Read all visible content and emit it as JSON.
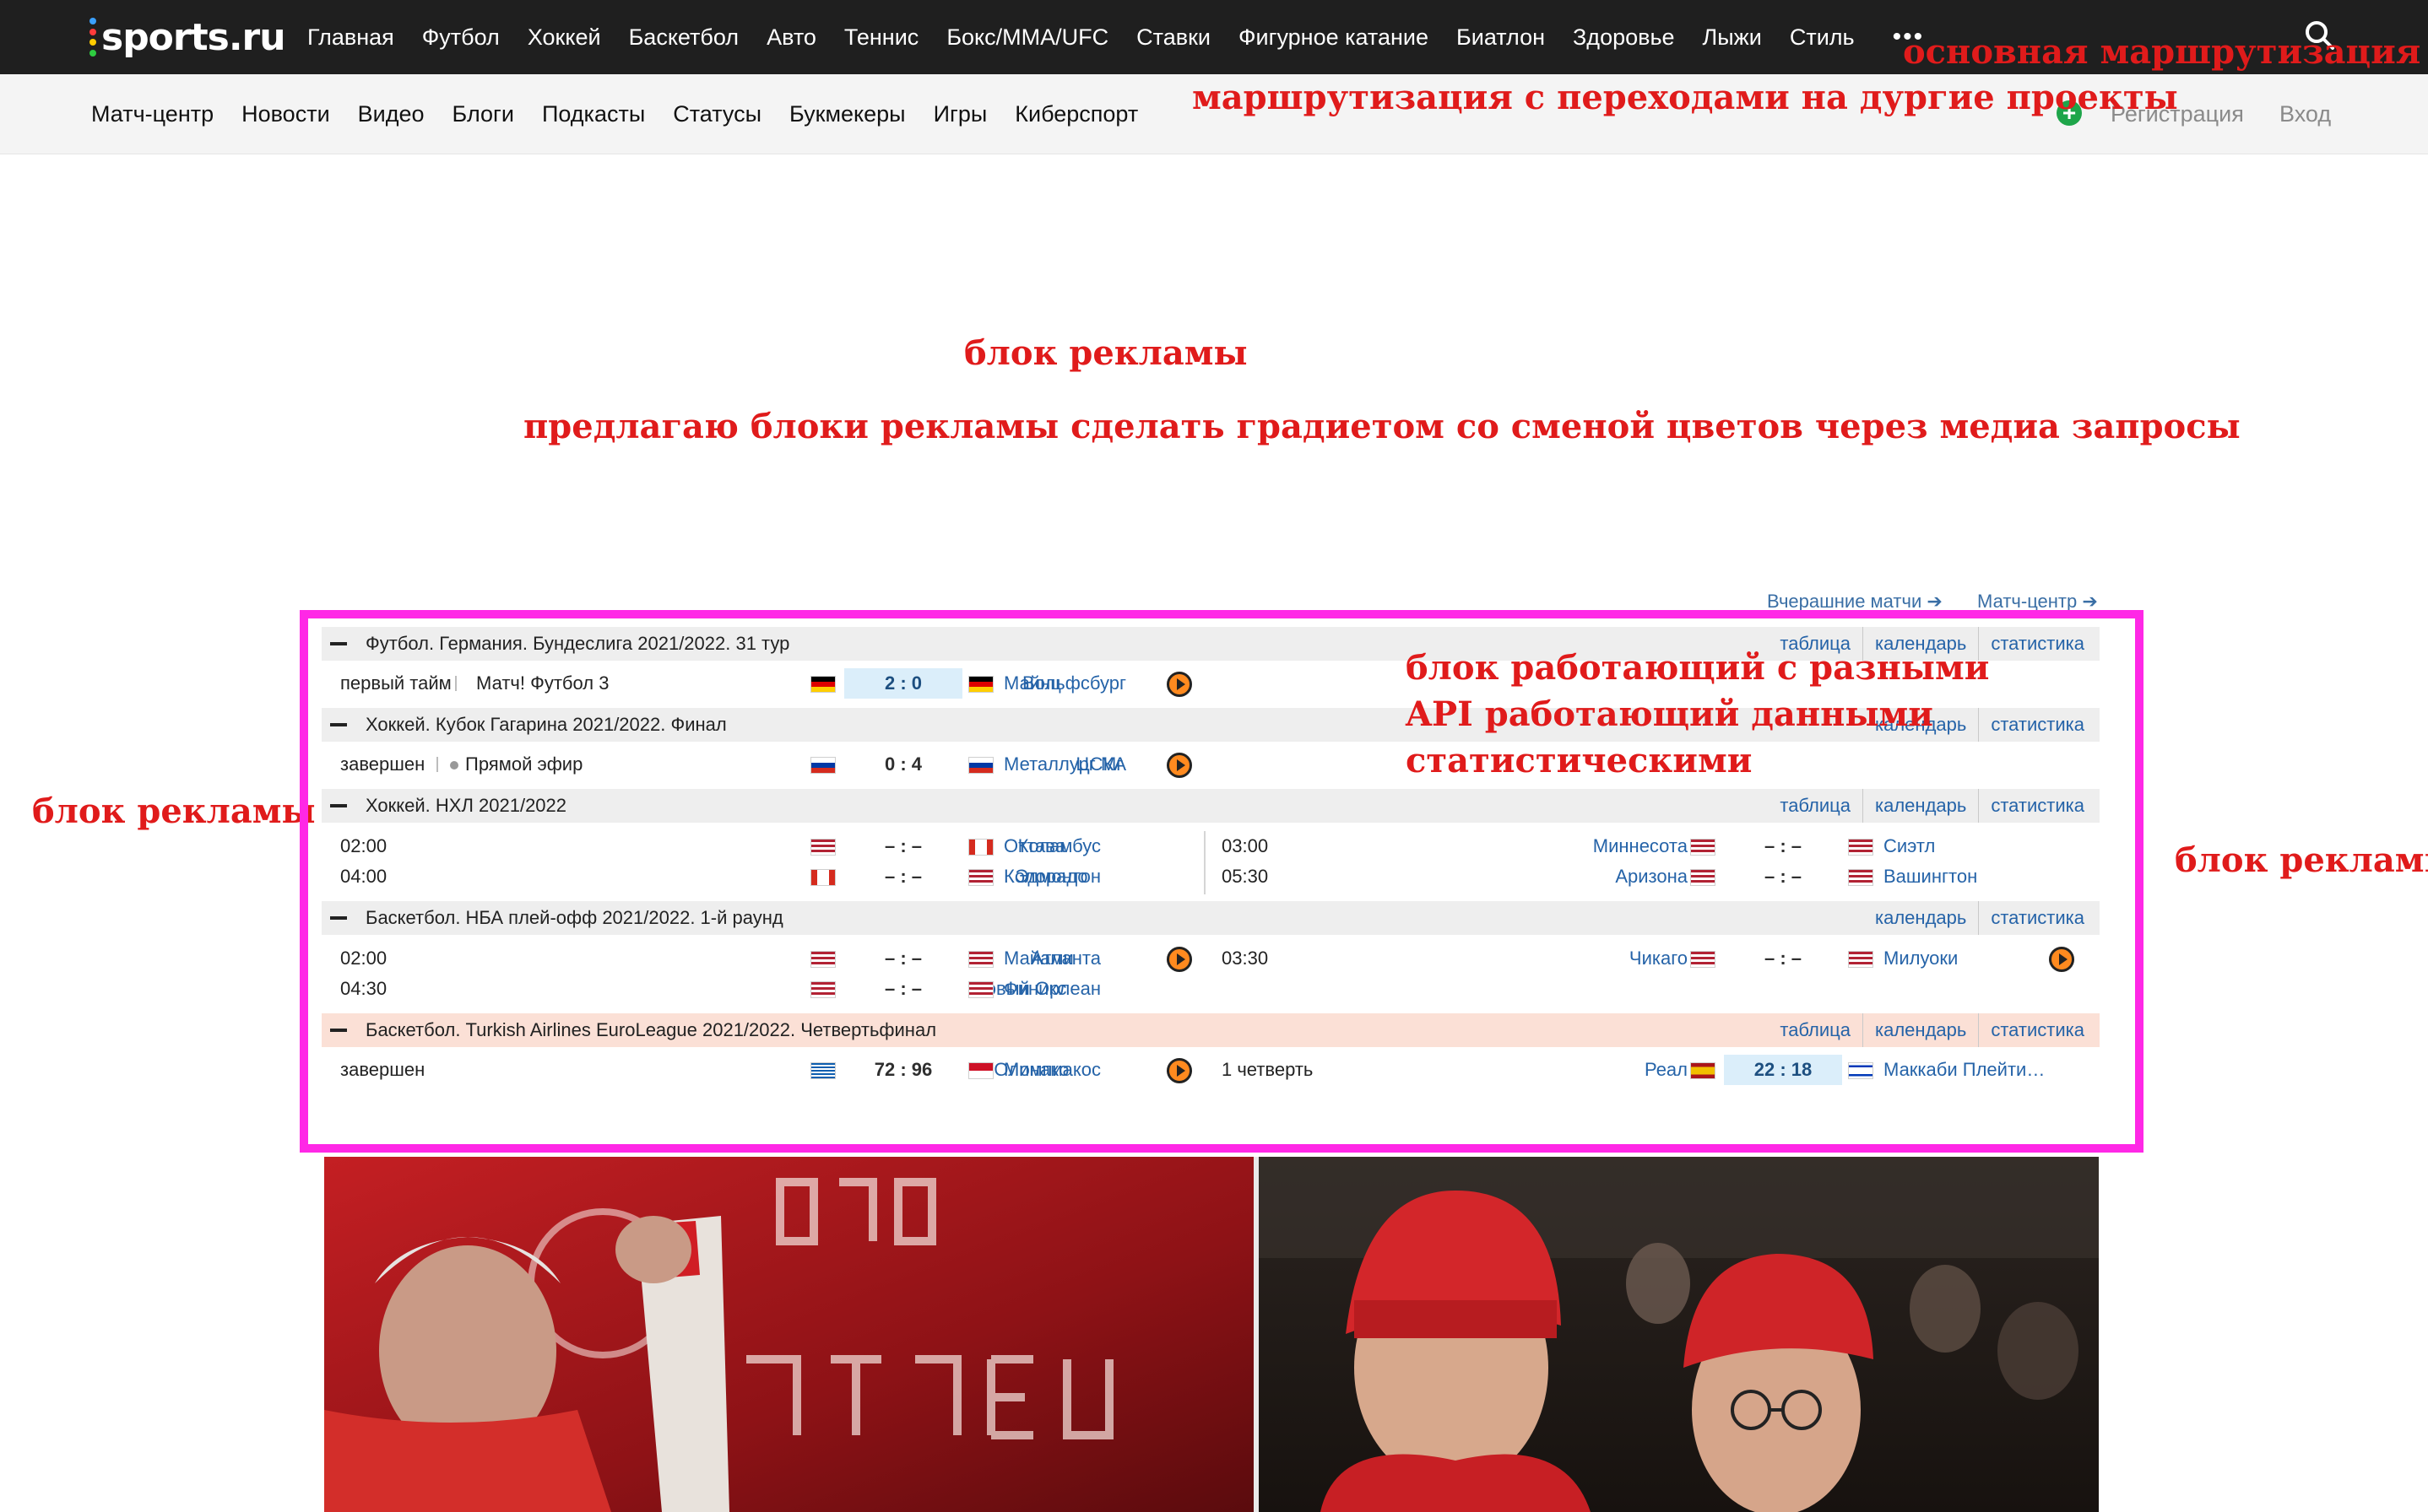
{
  "logo": {
    "text": "sports.ru"
  },
  "main_nav": [
    "Главная",
    "Футбол",
    "Хоккей",
    "Баскетбол",
    "Авто",
    "Теннис",
    "Бокс/MMA/UFC",
    "Ставки",
    "Фигурное катание",
    "Биатлон",
    "Здоровье",
    "Лыжи",
    "Стиль"
  ],
  "more_label": "•••",
  "sub_nav": [
    "Матч-центр",
    "Новости",
    "Видео",
    "Блоги",
    "Подкасты",
    "Статусы",
    "Букмекеры",
    "Игры",
    "Киберспорт"
  ],
  "auth": {
    "register": "Регистрация",
    "login": "Вход"
  },
  "plus_label": "+",
  "annotations": {
    "main_routing": "основная маршрутизация",
    "projects_routing": "маршрутизация с переходами на дургие проекты",
    "ad_top": "блок рекламы",
    "ad_gradient": "предлагаю блоки рекламы сделать градиетом со сменой цветов через медиа запросы",
    "ad_left": "блок рекламы",
    "ad_right": "блок рекламы",
    "api_block_1": "блок работающий с разными",
    "api_block_2": "API работающий данными",
    "api_block_3": "статистическими"
  },
  "match_center": {
    "yesterday_link": "Вчерашние матчи ➔",
    "center_link": "Матч-центр ➔",
    "links": {
      "table": "таблица",
      "calendar": "календарь",
      "stats": "статистика"
    },
    "sections": [
      {
        "title": "Футбол. Германия. Бундеслига 2021/2022. 31 тур"
      },
      {
        "title": "Хоккей. Кубок Гагарина 2021/2022. Финал"
      },
      {
        "title": "Хоккей. НХЛ 2021/2022"
      },
      {
        "title": "Баскетбол. НБА плей-офф 2021/2022. 1-й раунд"
      },
      {
        "title": "Баскетбол. Turkish Airlines EuroLeague 2021/2022. Четвертьфинал"
      }
    ],
    "football": {
      "status": "первый тайм",
      "broadcast": "Матч! Футбол 3",
      "home": "Вольфсбург",
      "score": "2 : 0",
      "away": "Майнц"
    },
    "khl": {
      "status": "завершен",
      "broadcast": "Прямой эфир",
      "home": "ЦСКА",
      "score": "0 : 4",
      "away": "Металлург Мг"
    },
    "nhl": [
      {
        "time": "02:00",
        "home": "Коламбус",
        "score": "– : –",
        "away": "Оттава"
      },
      {
        "time": "04:00",
        "home": "Эдмонтон",
        "score": "– : –",
        "away": "Колорадо"
      },
      {
        "time": "03:00",
        "home": "Миннесота",
        "score": "– : –",
        "away": "Сиэтл"
      },
      {
        "time": "05:30",
        "home": "Аризона",
        "score": "– : –",
        "away": "Вашингтон"
      }
    ],
    "nba": [
      {
        "time": "02:00",
        "home": "Атланта",
        "score": "– : –",
        "away": "Майами"
      },
      {
        "time": "04:30",
        "home": "Новый Орлеан",
        "score": "– : –",
        "away": "Финикс"
      },
      {
        "time": "03:30",
        "home": "Чикаго",
        "score": "– : –",
        "away": "Милуоки"
      }
    ],
    "euroleague": [
      {
        "status": "завершен",
        "home": "Олимпиакос",
        "score": "72 : 96",
        "away": "Монако"
      },
      {
        "status": "1 четверть",
        "home": "Реал",
        "score": "22 : 18",
        "away": "Маккаби Плейти…"
      }
    ]
  }
}
